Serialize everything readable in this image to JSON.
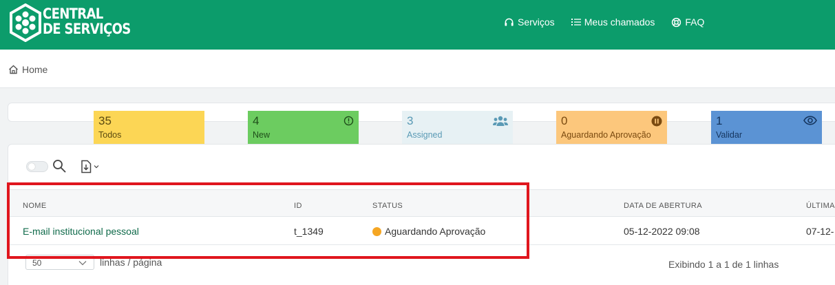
{
  "brand": {
    "line1": "CENTRAL",
    "line2": "DE SERVIÇOS"
  },
  "nav": [
    {
      "label": "Serviços",
      "icon": "headset-icon"
    },
    {
      "label": "Meus chamados",
      "icon": "list-icon"
    },
    {
      "label": "FAQ",
      "icon": "lifebuoy-icon"
    }
  ],
  "breadcrumb": {
    "label": "Home",
    "icon": "home-icon"
  },
  "cards": [
    {
      "count": "35",
      "label": "Todos",
      "color": "#fcd655"
    },
    {
      "count": "4",
      "label": "New",
      "icon": "alert-circle-icon",
      "color": "#6ccc60"
    },
    {
      "count": "3",
      "label": "Assigned",
      "icon": "users-icon",
      "color": "#e7f1f4"
    },
    {
      "count": "0",
      "label": "Aguardando Aprovação",
      "icon": "pause-circle-icon",
      "color": "#fcc77c"
    },
    {
      "count": "1",
      "label": "Validar",
      "icon": "eye-icon",
      "color": "#5b93d4"
    }
  ],
  "toolbar": {
    "search_icon": "search-icon",
    "export_icon": "file-download-icon"
  },
  "table": {
    "columns": [
      "NOME",
      "ID",
      "STATUS",
      "DATA DE ABERTURA",
      "ÚLTIMA"
    ],
    "rows": [
      {
        "nome": "E-mail institucional pessoal",
        "id": "t_1349",
        "status": "Aguardando Aprovação",
        "status_color": "#f5a623",
        "data_abertura": "05-12-2022 09:08",
        "ultima": "07-12-"
      }
    ]
  },
  "pagination": {
    "page_size": "50",
    "per_page_label": "linhas / página",
    "summary": "Exibindo 1 a 1 de 1 linhas"
  }
}
